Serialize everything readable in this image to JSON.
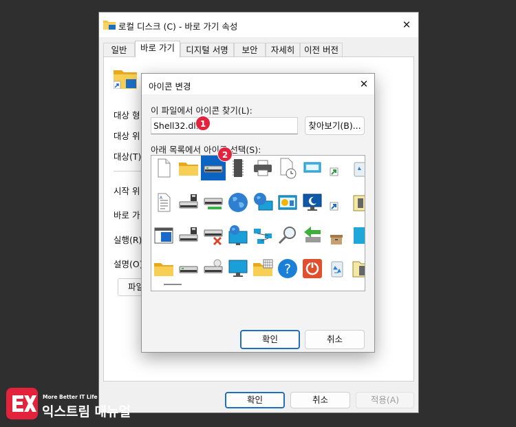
{
  "properties_window": {
    "title": "로컬 디스크 (C) - 바로 가기 속성",
    "close_glyph": "✕",
    "tabs": [
      {
        "label": "일반",
        "active": false
      },
      {
        "label": "바로 가기",
        "active": true
      },
      {
        "label": "디지털 서명",
        "active": false
      },
      {
        "label": "보안",
        "active": false
      },
      {
        "label": "자세히",
        "active": false
      },
      {
        "label": "이전 버전",
        "active": false
      }
    ],
    "fields": [
      {
        "label": "대상 형"
      },
      {
        "label": "대상 위"
      },
      {
        "label": "대상(T):"
      },
      {
        "label": "시작 위"
      },
      {
        "label": "바로 가"
      },
      {
        "label": "실행(R):"
      },
      {
        "label": "설명(O)"
      }
    ],
    "open_location_button": "파일",
    "buttons": {
      "ok": "확인",
      "cancel": "취소",
      "apply": "적용(A)"
    }
  },
  "change_icon_dialog": {
    "title": "아이콘 변경",
    "close_glyph": "✕",
    "file_label": "이 파일에서 아이콘 찾기(L):",
    "file_value": "Shell32.dll",
    "browse_button": "찾아보기(B)...",
    "list_label": "아래 목록에서 아이콘 선택(S):",
    "selected_icon": "drive-icon",
    "icon_rows": [
      [
        "blank-document-icon",
        "folder-icon",
        "drive-icon",
        "memory-chip-icon",
        "printer-icon",
        "document-clock-icon",
        "window-app-icon",
        "shortcut-arrow-icon",
        "recycle-bin-partial-icon"
      ],
      [
        "text-document-icon",
        "floppy-drive-icon",
        "network-drive-icon",
        "globe-icon",
        "network-globe-icon",
        "control-panel-icon",
        "sleep-monitor-icon",
        "shortcut-arrow-icon",
        "zip-partial-icon"
      ],
      [
        "window-blue-icon",
        "floppy-drive-2-icon",
        "drive-error-icon",
        "globe-monitor-icon",
        "network-nodes-icon",
        "magnifier-icon",
        "green-back-arrow-icon",
        "box-icon",
        "cyan-partial-icon"
      ],
      [
        "folder-2-icon",
        "drive-2-icon",
        "cd-drive-icon",
        "monitor-icon",
        "folder-grid-icon",
        "help-icon",
        "power-icon",
        "recycle-bin-icon",
        "zip-folder-partial-icon"
      ]
    ],
    "buttons": {
      "ok": "확인",
      "cancel": "취소"
    }
  },
  "annotations": {
    "badge_1": "1",
    "badge_2": "2"
  },
  "watermark": {
    "tagline": "More Better IT Life",
    "name": "익스트림 매뉴얼",
    "logo_text": "EX"
  },
  "colors": {
    "selection": "#0b63c4",
    "badge": "#e3223c",
    "accent_border": "#1f6fbf",
    "backdrop": "#2f2f2f"
  }
}
